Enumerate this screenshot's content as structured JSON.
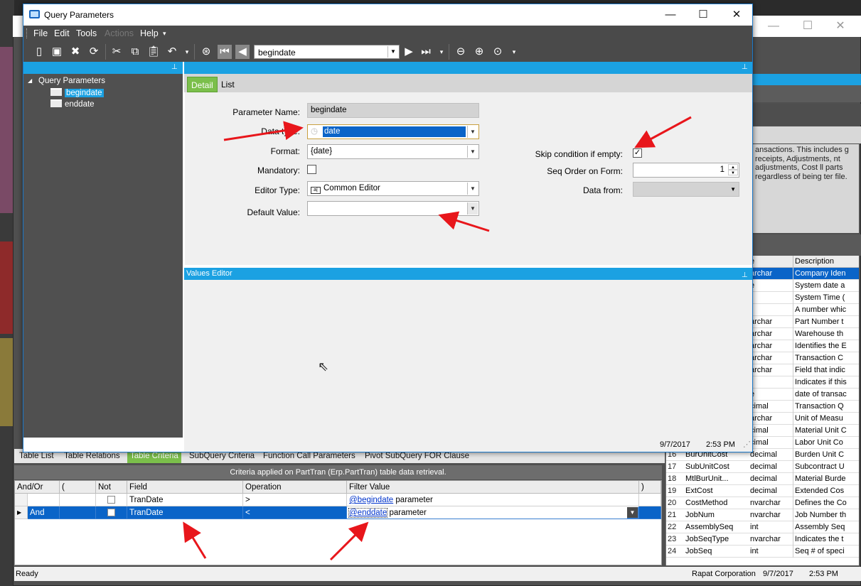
{
  "dialog": {
    "title": "Query Parameters",
    "menu": [
      "File",
      "Edit",
      "Tools",
      "Actions",
      "Help"
    ],
    "help_caret": "▾",
    "navigator_value": "begindate"
  },
  "tree": {
    "root": "Query Parameters",
    "items": [
      "begindate",
      "enddate"
    ]
  },
  "detail": {
    "tabs": [
      "Detail",
      "List"
    ],
    "parameter_name_label": "Parameter Name:",
    "parameter_name_value": "begindate",
    "data_type_label": "Data type:",
    "data_type_value": "date",
    "format_label": "Format:",
    "format_value": "{date}",
    "mandatory_label": "Mandatory:",
    "editor_type_label": "Editor Type:",
    "editor_type_value": "Common Editor",
    "default_value_label": "Default Value:",
    "skip_condition_label": "Skip condition if empty:",
    "seq_order_label": "Seq Order on Form:",
    "seq_order_value": "1",
    "data_from_label": "Data from:"
  },
  "values_editor": {
    "title": "Values Editor"
  },
  "dialog_status": {
    "date": "9/7/2017",
    "time": "2:53 PM"
  },
  "criteria": {
    "tabs": [
      "Table List",
      "Table Relations",
      "Table Criteria",
      "SubQuery Criteria",
      "Function Call Parameters",
      "Pivot SubQuery FOR Clause"
    ],
    "caption": "Criteria applied on PartTran (Erp.PartTran) table data retrieval.",
    "columns": [
      "And/Or",
      "(",
      "Not",
      "Field",
      "Operation",
      "Filter Value",
      ")"
    ],
    "rows": [
      {
        "andor": "",
        "field": "TranDate",
        "operation": ">",
        "filter_link": "@begindate",
        "filter_rest": "parameter"
      },
      {
        "andor": "And",
        "field": "TranDate",
        "operation": "<",
        "filter_link": "@enddate",
        "filter_rest": "parameter"
      }
    ]
  },
  "fields": {
    "header_type": "e",
    "header_desc": "Description",
    "rows": [
      {
        "n": "",
        "name": "",
        "type": "archar",
        "desc": "Company Iden"
      },
      {
        "n": "",
        "name": "",
        "type": "e",
        "desc": "System date a"
      },
      {
        "n": "",
        "name": "",
        "type": "",
        "desc": "System Time ("
      },
      {
        "n": "",
        "name": "",
        "type": "",
        "desc": "A number whic"
      },
      {
        "n": "",
        "name": "",
        "type": "archar",
        "desc": "Part Number t"
      },
      {
        "n": "",
        "name": "",
        "type": "archar",
        "desc": "Warehouse th"
      },
      {
        "n": "",
        "name": "",
        "type": "archar",
        "desc": "Identifies the E"
      },
      {
        "n": "",
        "name": "",
        "type": "archar",
        "desc": "Transaction C"
      },
      {
        "n": "",
        "name": "",
        "type": "archar",
        "desc": "Field that indic"
      },
      {
        "n": "",
        "name": "",
        "type": "",
        "desc": "Indicates if this"
      },
      {
        "n": "",
        "name": "",
        "type": "e",
        "desc": "date of transac"
      },
      {
        "n": "",
        "name": "",
        "type": "cimal",
        "desc": "Transaction Q"
      },
      {
        "n": "",
        "name": "",
        "type": "archar",
        "desc": "Unit of Measu"
      },
      {
        "n": "",
        "name": "",
        "type": "cimal",
        "desc": "Material Unit C"
      },
      {
        "n": "",
        "name": "",
        "type": "cimal",
        "desc": "Labor Unit Co"
      },
      {
        "n": "16",
        "name": "BurUnitCost",
        "type": "decimal",
        "desc": "Burden Unit C"
      },
      {
        "n": "17",
        "name": "SubUnitCost",
        "type": "decimal",
        "desc": "Subcontract U"
      },
      {
        "n": "18",
        "name": "MtlBurUnit...",
        "type": "decimal",
        "desc": "Material Burde"
      },
      {
        "n": "19",
        "name": "ExtCost",
        "type": "decimal",
        "desc": "Extended Cos"
      },
      {
        "n": "20",
        "name": "CostMethod",
        "type": "nvarchar",
        "desc": "Defines the Co"
      },
      {
        "n": "21",
        "name": "JobNum",
        "type": "nvarchar",
        "desc": "Job Number th"
      },
      {
        "n": "22",
        "name": "AssemblySeq",
        "type": "int",
        "desc": "Assembly Seq"
      },
      {
        "n": "23",
        "name": "JobSeqType",
        "type": "nvarchar",
        "desc": "Indicates the t"
      },
      {
        "n": "24",
        "name": "JobSeq",
        "type": "int",
        "desc": "Seq # of speci"
      }
    ]
  },
  "background_desc": "ansactions. This includes g receipts, Adjustments, nt adjustments, Cost ll parts regardless of being ter file.",
  "status_bar": {
    "left": "Ready",
    "company": "Rapat Corporation",
    "date": "9/7/2017",
    "time": "2:53 PM"
  },
  "colors": {
    "accent_blue": "#1ba1e2",
    "selection_blue": "#0a64c8",
    "active_tab_green": "#7bbf4b",
    "annotation_red": "#e8161b"
  }
}
